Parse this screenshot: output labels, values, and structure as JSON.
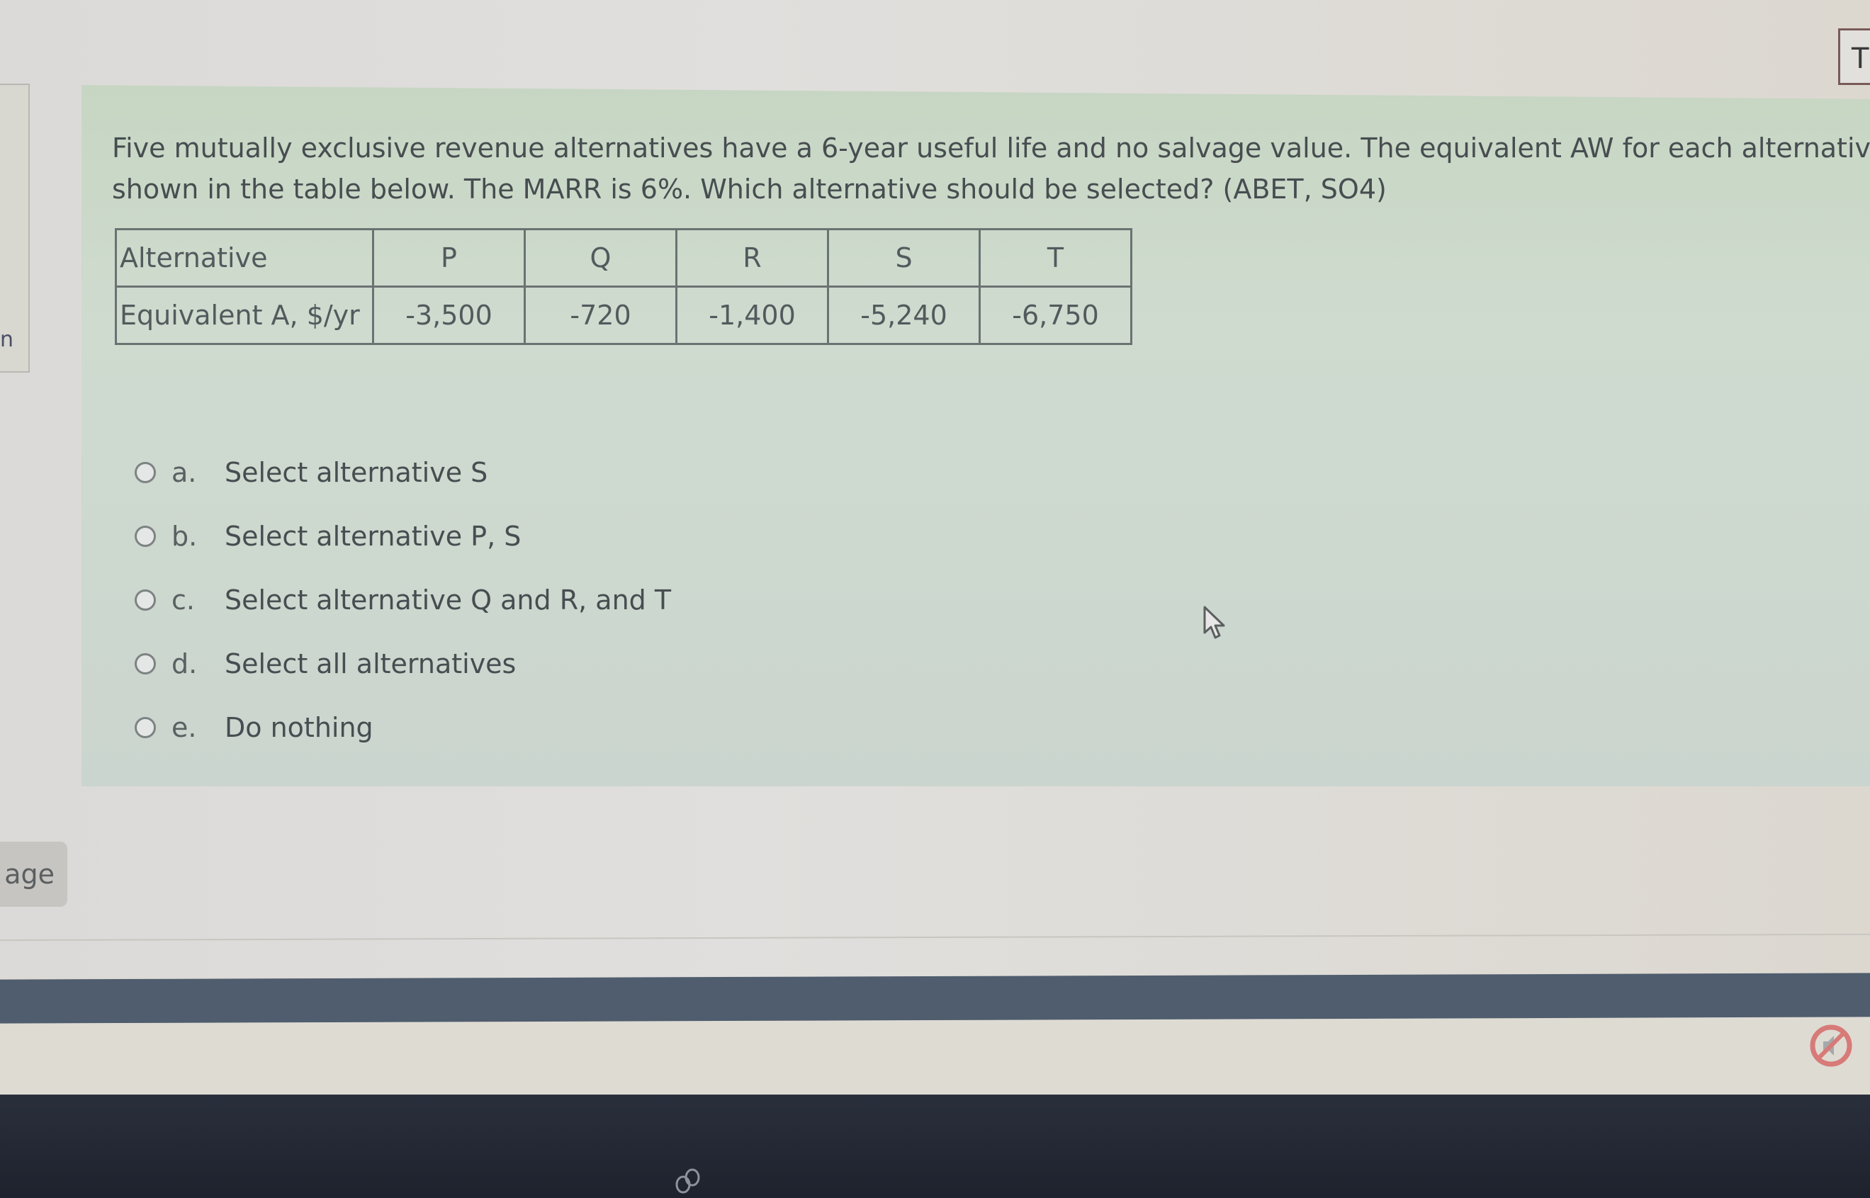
{
  "question": {
    "line1": "Five mutually exclusive revenue alternatives have a 6-year useful life and no salvage value. The equivalent AW for each alternative was calc",
    "line2": "shown in the table below. The MARR is 6%. Which alternative should be selected? (ABET, SO4)"
  },
  "table": {
    "header_label": "Alternative",
    "row_label": "Equivalent A, $/yr",
    "alternatives": [
      "P",
      "Q",
      "R",
      "S",
      "T"
    ],
    "values": [
      "-3,500",
      "-720",
      "-1,400",
      "-5,240",
      "-6,750"
    ]
  },
  "options": [
    {
      "letter": "a.",
      "text": "Select alternative S",
      "selected": false
    },
    {
      "letter": "b.",
      "text": "Select alternative P, S",
      "selected": false
    },
    {
      "letter": "c.",
      "text": "Select alternative Q and R, and T",
      "selected": false
    },
    {
      "letter": "d.",
      "text": "Select all alternatives",
      "selected": false
    },
    {
      "letter": "e.",
      "text": "Do nothing",
      "selected": false
    }
  ],
  "sidebar": {
    "partial_letter": "n",
    "page_button_label": "age"
  },
  "top_right_box_label": "T",
  "icons": {
    "cursor": "mouse-pointer-icon",
    "no_sound": "speaker-muted-icon",
    "logo": "infinity-logo-icon"
  },
  "colors": {
    "panel": "#cbd8cb",
    "taskbar": "#4f5d6e",
    "bezel": "#23272f",
    "muted_icon": "#d77a78"
  }
}
